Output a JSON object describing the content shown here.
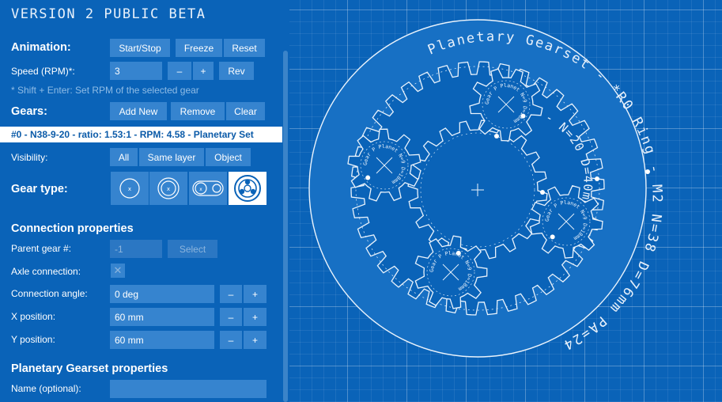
{
  "app": {
    "title": "VERSION 2 PUBLIC BETA"
  },
  "animation": {
    "label": "Animation:",
    "start_stop": "Start/Stop",
    "freeze": "Freeze",
    "reset": "Reset"
  },
  "speed": {
    "label": "Speed (RPM)*:",
    "value": "3",
    "minus": "–",
    "plus": "+",
    "rev": "Rev",
    "hint": "* Shift + Enter: Set RPM of the selected gear"
  },
  "gears": {
    "label": "Gears:",
    "add": "Add New",
    "remove": "Remove",
    "clear": "Clear",
    "selected": "#0 - N38-9-20 - ratio: 1.53:1 - RPM: 4.58 - Planetary Set"
  },
  "visibility": {
    "label": "Visibility:",
    "all": "All",
    "same_layer": "Same layer",
    "object": "Object"
  },
  "gear_type": {
    "label": "Gear type:",
    "types": [
      "spur-gear-icon",
      "internal-gear-icon",
      "chain-icon",
      "planetary-gear-icon"
    ],
    "selected_index": 3
  },
  "connection": {
    "heading": "Connection properties",
    "parent_label": "Parent gear #:",
    "parent_placeholder": "-1",
    "select": "Select",
    "axle_label": "Axle connection:",
    "angle_label": "Connection angle:",
    "angle_value": "0 deg",
    "x_label": "X position:",
    "x_value": "60 mm",
    "y_label": "Y position:",
    "y_value": "60 mm",
    "minus": "–",
    "plus": "+"
  },
  "planetary": {
    "heading": "Planetary Gearset properties",
    "name_label": "Name (optional):",
    "name_value": ""
  },
  "drawing": {
    "ring_text": "Planetary Gearset - *R0 Ring - M2 N=38 D=76mm PA=24",
    "sun_text": "Sun S0* - N=20 D=40mm",
    "planet_text": "Gear P Planet N=9 D=18mm",
    "line_color": "#eaf3fc",
    "bg_color": "#0a63b8"
  }
}
